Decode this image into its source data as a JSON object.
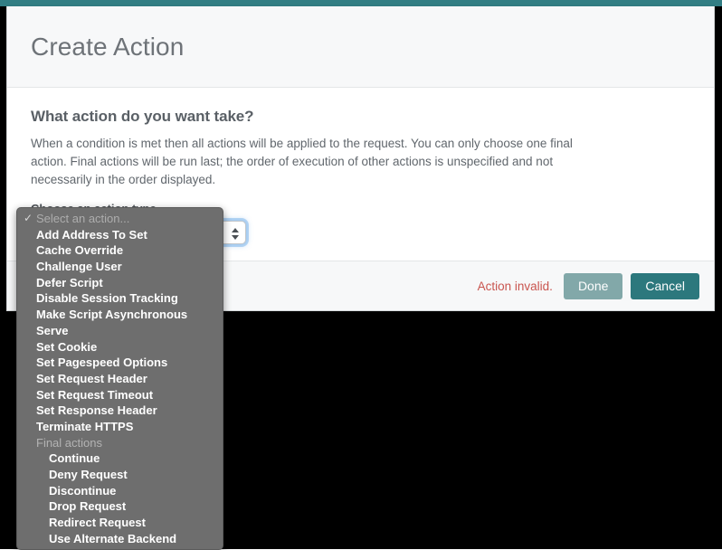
{
  "theme": {
    "accent_teal": "#327e84",
    "button_primary_disabled": "#82a8a9",
    "button_secondary": "#2c787d",
    "error_red": "#c9554f",
    "dropdown_bg": "#6e6e6e",
    "header_bg": "#f7f8f9"
  },
  "modal": {
    "title": "Create Action",
    "body": {
      "heading": "What action do you want take?",
      "description": "When a condition is met then all actions will be applied to the request. You can only choose one final action. Final actions will be run last; the order of execution of other actions is unspecified and not necessarily in the order displayed.",
      "field_label": "Choose an action type",
      "select": {
        "selected_value": "Select an action...",
        "stepper_up_icon": "triangle-up-icon",
        "stepper_down_icon": "triangle-down-icon"
      }
    },
    "footer": {
      "error_text": "Action invalid.",
      "done_label": "Done",
      "cancel_label": "Cancel"
    }
  },
  "dropdown": {
    "check_glyph": "✓",
    "items": [
      {
        "label": "Select an action...",
        "type": "placeholder",
        "selected": true
      },
      {
        "label": "Add Address To Set",
        "type": "option"
      },
      {
        "label": "Cache Override",
        "type": "option"
      },
      {
        "label": "Challenge User",
        "type": "option"
      },
      {
        "label": "Defer Script",
        "type": "option"
      },
      {
        "label": "Disable Session Tracking",
        "type": "option"
      },
      {
        "label": "Make Script Asynchronous",
        "type": "option"
      },
      {
        "label": "Serve",
        "type": "option"
      },
      {
        "label": "Set Cookie",
        "type": "option"
      },
      {
        "label": "Set Pagespeed Options",
        "type": "option"
      },
      {
        "label": "Set Request Header",
        "type": "option"
      },
      {
        "label": "Set Request Timeout",
        "type": "option"
      },
      {
        "label": "Set Response Header",
        "type": "option"
      },
      {
        "label": "Terminate HTTPS",
        "type": "option"
      },
      {
        "label": "Final actions",
        "type": "group"
      },
      {
        "label": "Continue",
        "type": "option-indent"
      },
      {
        "label": "Deny Request",
        "type": "option-indent"
      },
      {
        "label": "Discontinue",
        "type": "option-indent"
      },
      {
        "label": "Drop Request",
        "type": "option-indent"
      },
      {
        "label": "Redirect Request",
        "type": "option-indent"
      },
      {
        "label": "Use Alternate Backend",
        "type": "option-indent"
      }
    ]
  }
}
